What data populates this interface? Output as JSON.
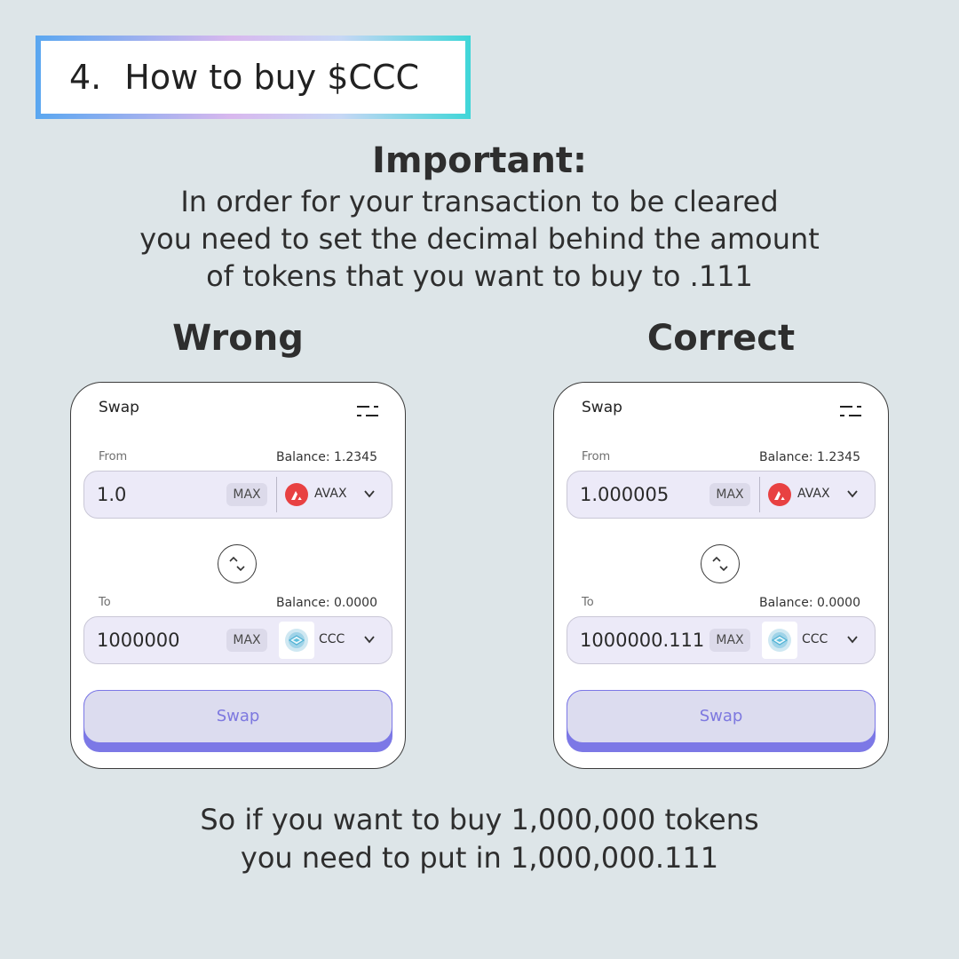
{
  "title": {
    "number": "4.",
    "text": "How to buy $CCC"
  },
  "important": {
    "heading": "Important:",
    "lines": [
      "In order for your transaction to be cleared",
      "you need to set the decimal behind the amount",
      "of tokens that you want to buy to .111"
    ]
  },
  "wrong": {
    "label": "Wrong",
    "swap_title": "Swap",
    "from_label": "From",
    "from_balance": "Balance: 1.2345",
    "from_amount": "1.0",
    "from_max": "MAX",
    "from_token": "AVAX",
    "to_label": "To",
    "to_balance": "Balance: 0.0000",
    "to_amount": "1000000",
    "to_max": "MAX",
    "to_token": "CCC",
    "swap_button": "Swap"
  },
  "correct": {
    "label": "Correct",
    "swap_title": "Swap",
    "from_label": "From",
    "from_balance": "Balance: 1.2345",
    "from_amount": "1.000005",
    "from_max": "MAX",
    "from_token": "AVAX",
    "to_label": "To",
    "to_balance": "Balance: 0.0000",
    "to_amount": "1000000.111",
    "to_max": "MAX",
    "to_token": "CCC",
    "swap_button": "Swap"
  },
  "bottom": {
    "lines": [
      "So if you want to buy 1,000,000 tokens",
      "you need to put in 1,000,000.111"
    ]
  },
  "icons": {
    "settings": "settings-sliders-icon",
    "avax": "avax-logo-icon",
    "ccc": "ccc-token-icon",
    "chevron": "chevron-down-icon",
    "swap_direction": "swap-direction-icon"
  },
  "colors": {
    "background": "#dde5e8",
    "field_bg": "#eceaf8",
    "swap_button_accent": "#7c78e6",
    "avax_red": "#e84142"
  }
}
